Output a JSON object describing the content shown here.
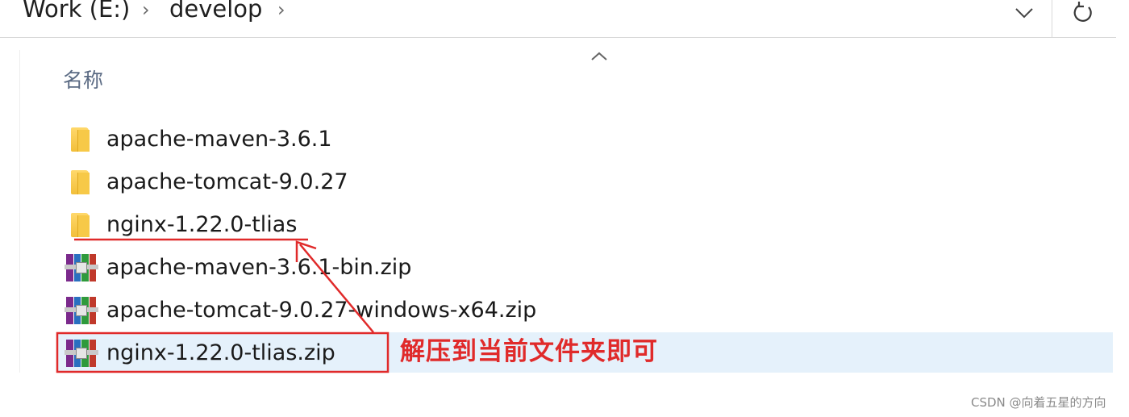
{
  "address_bar": {
    "crumbs": [
      "Work (E:)",
      "develop"
    ],
    "dropdown_icon": "chevron-down-icon",
    "refresh_icon": "refresh-icon"
  },
  "list": {
    "sort_icon": "sort-ascending-icon",
    "column_header": "名称",
    "files": [
      {
        "name": "apache-maven-3.6.1",
        "type": "folder"
      },
      {
        "name": "apache-tomcat-9.0.27",
        "type": "folder"
      },
      {
        "name": "nginx-1.22.0-tlias",
        "type": "folder"
      },
      {
        "name": "apache-maven-3.6.1-bin.zip",
        "type": "archive"
      },
      {
        "name": "apache-tomcat-9.0.27-windows-x64.zip",
        "type": "archive"
      },
      {
        "name": "nginx-1.22.0-tlias.zip",
        "type": "archive",
        "selected": true
      }
    ]
  },
  "annotation": {
    "text": "解压到当前文件夹即可",
    "color": "#e02a2a"
  },
  "watermark": "CSDN @向着五星的方向",
  "colors": {
    "selection": "#e5f1fb",
    "header_text": "#5a6a83",
    "folder": "#f2bf3a"
  }
}
